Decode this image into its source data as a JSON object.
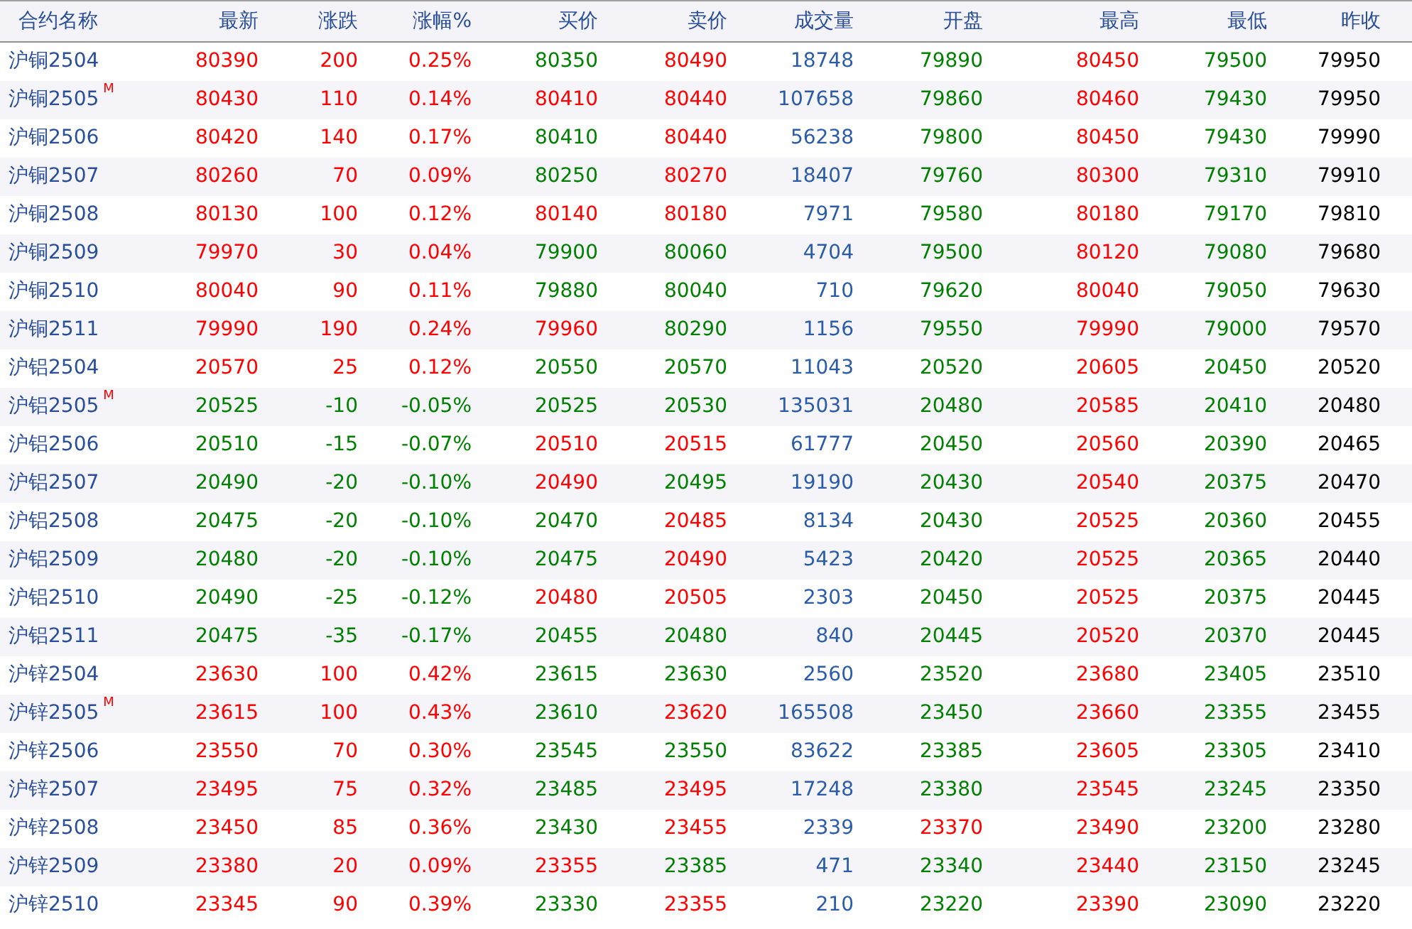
{
  "table": {
    "columns": [
      "合约名称",
      "最新",
      "涨跌",
      "涨幅%",
      "买价",
      "卖价",
      "成交量",
      "开盘",
      "最高",
      "最低",
      "昨收"
    ],
    "rows": [
      {
        "cells": [
          {
            "text": "沪铜2504",
            "color": "#2a4f9a"
          },
          {
            "text": "80390",
            "color": "#ff0000"
          },
          {
            "text": "200",
            "color": "#ff0000"
          },
          {
            "text": "0.25%",
            "color": "#ff0000"
          },
          {
            "text": "80350",
            "color": "#008000"
          },
          {
            "text": "80490",
            "color": "#ff0000"
          },
          {
            "text": "18748",
            "color": "#2a5caa"
          },
          {
            "text": "79890",
            "color": "#008000"
          },
          {
            "text": "80450",
            "color": "#ff0000"
          },
          {
            "text": "79500",
            "color": "#008000"
          },
          {
            "text": "79950",
            "color": "#000000"
          }
        ]
      },
      {
        "cells": [
          {
            "text": "沪铜2505",
            "color": "#2a4f9a",
            "badge": "M"
          },
          {
            "text": "80430",
            "color": "#ff0000"
          },
          {
            "text": "110",
            "color": "#ff0000"
          },
          {
            "text": "0.14%",
            "color": "#ff0000"
          },
          {
            "text": "80410",
            "color": "#ff0000"
          },
          {
            "text": "80440",
            "color": "#ff0000"
          },
          {
            "text": "107658",
            "color": "#2a5caa"
          },
          {
            "text": "79860",
            "color": "#008000"
          },
          {
            "text": "80460",
            "color": "#ff0000"
          },
          {
            "text": "79430",
            "color": "#008000"
          },
          {
            "text": "79950",
            "color": "#000000"
          }
        ]
      },
      {
        "cells": [
          {
            "text": "沪铜2506",
            "color": "#2a4f9a"
          },
          {
            "text": "80420",
            "color": "#ff0000"
          },
          {
            "text": "140",
            "color": "#ff0000"
          },
          {
            "text": "0.17%",
            "color": "#ff0000"
          },
          {
            "text": "80410",
            "color": "#008000"
          },
          {
            "text": "80440",
            "color": "#ff0000"
          },
          {
            "text": "56238",
            "color": "#2a5caa"
          },
          {
            "text": "79800",
            "color": "#008000"
          },
          {
            "text": "80450",
            "color": "#ff0000"
          },
          {
            "text": "79430",
            "color": "#008000"
          },
          {
            "text": "79990",
            "color": "#000000"
          }
        ]
      },
      {
        "cells": [
          {
            "text": "沪铜2507",
            "color": "#2a4f9a"
          },
          {
            "text": "80260",
            "color": "#ff0000"
          },
          {
            "text": "70",
            "color": "#ff0000"
          },
          {
            "text": "0.09%",
            "color": "#ff0000"
          },
          {
            "text": "80250",
            "color": "#008000"
          },
          {
            "text": "80270",
            "color": "#ff0000"
          },
          {
            "text": "18407",
            "color": "#2a5caa"
          },
          {
            "text": "79760",
            "color": "#008000"
          },
          {
            "text": "80300",
            "color": "#ff0000"
          },
          {
            "text": "79310",
            "color": "#008000"
          },
          {
            "text": "79910",
            "color": "#000000"
          }
        ]
      },
      {
        "cells": [
          {
            "text": "沪铜2508",
            "color": "#2a4f9a"
          },
          {
            "text": "80130",
            "color": "#ff0000"
          },
          {
            "text": "100",
            "color": "#ff0000"
          },
          {
            "text": "0.12%",
            "color": "#ff0000"
          },
          {
            "text": "80140",
            "color": "#ff0000"
          },
          {
            "text": "80180",
            "color": "#ff0000"
          },
          {
            "text": "7971",
            "color": "#2a5caa"
          },
          {
            "text": "79580",
            "color": "#008000"
          },
          {
            "text": "80180",
            "color": "#ff0000"
          },
          {
            "text": "79170",
            "color": "#008000"
          },
          {
            "text": "79810",
            "color": "#000000"
          }
        ]
      },
      {
        "cells": [
          {
            "text": "沪铜2509",
            "color": "#2a4f9a"
          },
          {
            "text": "79970",
            "color": "#ff0000"
          },
          {
            "text": "30",
            "color": "#ff0000"
          },
          {
            "text": "0.04%",
            "color": "#ff0000"
          },
          {
            "text": "79900",
            "color": "#008000"
          },
          {
            "text": "80060",
            "color": "#008000"
          },
          {
            "text": "4704",
            "color": "#2a5caa"
          },
          {
            "text": "79500",
            "color": "#008000"
          },
          {
            "text": "80120",
            "color": "#ff0000"
          },
          {
            "text": "79080",
            "color": "#008000"
          },
          {
            "text": "79680",
            "color": "#000000"
          }
        ]
      },
      {
        "cells": [
          {
            "text": "沪铜2510",
            "color": "#2a4f9a"
          },
          {
            "text": "80040",
            "color": "#ff0000"
          },
          {
            "text": "90",
            "color": "#ff0000"
          },
          {
            "text": "0.11%",
            "color": "#ff0000"
          },
          {
            "text": "79880",
            "color": "#008000"
          },
          {
            "text": "80040",
            "color": "#008000"
          },
          {
            "text": "710",
            "color": "#2a5caa"
          },
          {
            "text": "79620",
            "color": "#008000"
          },
          {
            "text": "80040",
            "color": "#ff0000"
          },
          {
            "text": "79050",
            "color": "#008000"
          },
          {
            "text": "79630",
            "color": "#000000"
          }
        ]
      },
      {
        "cells": [
          {
            "text": "沪铜2511",
            "color": "#2a4f9a"
          },
          {
            "text": "79990",
            "color": "#ff0000"
          },
          {
            "text": "190",
            "color": "#ff0000"
          },
          {
            "text": "0.24%",
            "color": "#ff0000"
          },
          {
            "text": "79960",
            "color": "#ff0000"
          },
          {
            "text": "80290",
            "color": "#008000"
          },
          {
            "text": "1156",
            "color": "#2a5caa"
          },
          {
            "text": "79550",
            "color": "#008000"
          },
          {
            "text": "79990",
            "color": "#ff0000"
          },
          {
            "text": "79000",
            "color": "#008000"
          },
          {
            "text": "79570",
            "color": "#000000"
          }
        ]
      },
      {
        "cells": [
          {
            "text": "沪铝2504",
            "color": "#2a4f9a"
          },
          {
            "text": "20570",
            "color": "#ff0000"
          },
          {
            "text": "25",
            "color": "#ff0000"
          },
          {
            "text": "0.12%",
            "color": "#ff0000"
          },
          {
            "text": "20550",
            "color": "#008000"
          },
          {
            "text": "20570",
            "color": "#008000"
          },
          {
            "text": "11043",
            "color": "#2a5caa"
          },
          {
            "text": "20520",
            "color": "#008000"
          },
          {
            "text": "20605",
            "color": "#ff0000"
          },
          {
            "text": "20450",
            "color": "#008000"
          },
          {
            "text": "20520",
            "color": "#000000"
          }
        ]
      },
      {
        "cells": [
          {
            "text": "沪铝2505",
            "color": "#2a4f9a",
            "badge": "M"
          },
          {
            "text": "20525",
            "color": "#008000"
          },
          {
            "text": "-10",
            "color": "#008000"
          },
          {
            "text": "-0.05%",
            "color": "#008000"
          },
          {
            "text": "20525",
            "color": "#008000"
          },
          {
            "text": "20530",
            "color": "#008000"
          },
          {
            "text": "135031",
            "color": "#2a5caa"
          },
          {
            "text": "20480",
            "color": "#008000"
          },
          {
            "text": "20585",
            "color": "#ff0000"
          },
          {
            "text": "20410",
            "color": "#008000"
          },
          {
            "text": "20480",
            "color": "#000000"
          }
        ]
      },
      {
        "cells": [
          {
            "text": "沪铝2506",
            "color": "#2a4f9a"
          },
          {
            "text": "20510",
            "color": "#008000"
          },
          {
            "text": "-15",
            "color": "#008000"
          },
          {
            "text": "-0.07%",
            "color": "#008000"
          },
          {
            "text": "20510",
            "color": "#ff0000"
          },
          {
            "text": "20515",
            "color": "#ff0000"
          },
          {
            "text": "61777",
            "color": "#2a5caa"
          },
          {
            "text": "20450",
            "color": "#008000"
          },
          {
            "text": "20560",
            "color": "#ff0000"
          },
          {
            "text": "20390",
            "color": "#008000"
          },
          {
            "text": "20465",
            "color": "#000000"
          }
        ]
      },
      {
        "cells": [
          {
            "text": "沪铝2507",
            "color": "#2a4f9a"
          },
          {
            "text": "20490",
            "color": "#008000"
          },
          {
            "text": "-20",
            "color": "#008000"
          },
          {
            "text": "-0.10%",
            "color": "#008000"
          },
          {
            "text": "20490",
            "color": "#ff0000"
          },
          {
            "text": "20495",
            "color": "#008000"
          },
          {
            "text": "19190",
            "color": "#2a5caa"
          },
          {
            "text": "20430",
            "color": "#008000"
          },
          {
            "text": "20540",
            "color": "#ff0000"
          },
          {
            "text": "20375",
            "color": "#008000"
          },
          {
            "text": "20470",
            "color": "#000000"
          }
        ]
      },
      {
        "cells": [
          {
            "text": "沪铝2508",
            "color": "#2a4f9a"
          },
          {
            "text": "20475",
            "color": "#008000"
          },
          {
            "text": "-20",
            "color": "#008000"
          },
          {
            "text": "-0.10%",
            "color": "#008000"
          },
          {
            "text": "20470",
            "color": "#008000"
          },
          {
            "text": "20485",
            "color": "#ff0000"
          },
          {
            "text": "8134",
            "color": "#2a5caa"
          },
          {
            "text": "20430",
            "color": "#008000"
          },
          {
            "text": "20525",
            "color": "#ff0000"
          },
          {
            "text": "20360",
            "color": "#008000"
          },
          {
            "text": "20455",
            "color": "#000000"
          }
        ]
      },
      {
        "cells": [
          {
            "text": "沪铝2509",
            "color": "#2a4f9a"
          },
          {
            "text": "20480",
            "color": "#008000"
          },
          {
            "text": "-20",
            "color": "#008000"
          },
          {
            "text": "-0.10%",
            "color": "#008000"
          },
          {
            "text": "20475",
            "color": "#008000"
          },
          {
            "text": "20490",
            "color": "#ff0000"
          },
          {
            "text": "5423",
            "color": "#2a5caa"
          },
          {
            "text": "20420",
            "color": "#008000"
          },
          {
            "text": "20525",
            "color": "#ff0000"
          },
          {
            "text": "20365",
            "color": "#008000"
          },
          {
            "text": "20440",
            "color": "#000000"
          }
        ]
      },
      {
        "cells": [
          {
            "text": "沪铝2510",
            "color": "#2a4f9a"
          },
          {
            "text": "20490",
            "color": "#008000"
          },
          {
            "text": "-25",
            "color": "#008000"
          },
          {
            "text": "-0.12%",
            "color": "#008000"
          },
          {
            "text": "20480",
            "color": "#ff0000"
          },
          {
            "text": "20505",
            "color": "#ff0000"
          },
          {
            "text": "2303",
            "color": "#2a5caa"
          },
          {
            "text": "20450",
            "color": "#008000"
          },
          {
            "text": "20525",
            "color": "#ff0000"
          },
          {
            "text": "20375",
            "color": "#008000"
          },
          {
            "text": "20445",
            "color": "#000000"
          }
        ]
      },
      {
        "cells": [
          {
            "text": "沪铝2511",
            "color": "#2a4f9a"
          },
          {
            "text": "20475",
            "color": "#008000"
          },
          {
            "text": "-35",
            "color": "#008000"
          },
          {
            "text": "-0.17%",
            "color": "#008000"
          },
          {
            "text": "20455",
            "color": "#008000"
          },
          {
            "text": "20480",
            "color": "#008000"
          },
          {
            "text": "840",
            "color": "#2a5caa"
          },
          {
            "text": "20445",
            "color": "#008000"
          },
          {
            "text": "20520",
            "color": "#ff0000"
          },
          {
            "text": "20370",
            "color": "#008000"
          },
          {
            "text": "20445",
            "color": "#000000"
          }
        ]
      },
      {
        "cells": [
          {
            "text": "沪锌2504",
            "color": "#2a4f9a"
          },
          {
            "text": "23630",
            "color": "#ff0000"
          },
          {
            "text": "100",
            "color": "#ff0000"
          },
          {
            "text": "0.42%",
            "color": "#ff0000"
          },
          {
            "text": "23615",
            "color": "#008000"
          },
          {
            "text": "23630",
            "color": "#008000"
          },
          {
            "text": "2560",
            "color": "#2a5caa"
          },
          {
            "text": "23520",
            "color": "#008000"
          },
          {
            "text": "23680",
            "color": "#ff0000"
          },
          {
            "text": "23405",
            "color": "#008000"
          },
          {
            "text": "23510",
            "color": "#000000"
          }
        ]
      },
      {
        "cells": [
          {
            "text": "沪锌2505",
            "color": "#2a4f9a",
            "badge": "M"
          },
          {
            "text": "23615",
            "color": "#ff0000"
          },
          {
            "text": "100",
            "color": "#ff0000"
          },
          {
            "text": "0.43%",
            "color": "#ff0000"
          },
          {
            "text": "23610",
            "color": "#008000"
          },
          {
            "text": "23620",
            "color": "#ff0000"
          },
          {
            "text": "165508",
            "color": "#2a5caa"
          },
          {
            "text": "23450",
            "color": "#008000"
          },
          {
            "text": "23660",
            "color": "#ff0000"
          },
          {
            "text": "23355",
            "color": "#008000"
          },
          {
            "text": "23455",
            "color": "#000000"
          }
        ]
      },
      {
        "cells": [
          {
            "text": "沪锌2506",
            "color": "#2a4f9a"
          },
          {
            "text": "23550",
            "color": "#ff0000"
          },
          {
            "text": "70",
            "color": "#ff0000"
          },
          {
            "text": "0.30%",
            "color": "#ff0000"
          },
          {
            "text": "23545",
            "color": "#008000"
          },
          {
            "text": "23550",
            "color": "#008000"
          },
          {
            "text": "83622",
            "color": "#2a5caa"
          },
          {
            "text": "23385",
            "color": "#008000"
          },
          {
            "text": "23605",
            "color": "#ff0000"
          },
          {
            "text": "23305",
            "color": "#008000"
          },
          {
            "text": "23410",
            "color": "#000000"
          }
        ]
      },
      {
        "cells": [
          {
            "text": "沪锌2507",
            "color": "#2a4f9a"
          },
          {
            "text": "23495",
            "color": "#ff0000"
          },
          {
            "text": "75",
            "color": "#ff0000"
          },
          {
            "text": "0.32%",
            "color": "#ff0000"
          },
          {
            "text": "23485",
            "color": "#008000"
          },
          {
            "text": "23495",
            "color": "#ff0000"
          },
          {
            "text": "17248",
            "color": "#2a5caa"
          },
          {
            "text": "23380",
            "color": "#008000"
          },
          {
            "text": "23545",
            "color": "#ff0000"
          },
          {
            "text": "23245",
            "color": "#008000"
          },
          {
            "text": "23350",
            "color": "#000000"
          }
        ]
      },
      {
        "cells": [
          {
            "text": "沪锌2508",
            "color": "#2a4f9a"
          },
          {
            "text": "23450",
            "color": "#ff0000"
          },
          {
            "text": "85",
            "color": "#ff0000"
          },
          {
            "text": "0.36%",
            "color": "#ff0000"
          },
          {
            "text": "23430",
            "color": "#008000"
          },
          {
            "text": "23455",
            "color": "#ff0000"
          },
          {
            "text": "2339",
            "color": "#2a5caa"
          },
          {
            "text": "23370",
            "color": "#ff0000"
          },
          {
            "text": "23490",
            "color": "#ff0000"
          },
          {
            "text": "23200",
            "color": "#008000"
          },
          {
            "text": "23280",
            "color": "#000000"
          }
        ]
      },
      {
        "cells": [
          {
            "text": "沪锌2509",
            "color": "#2a4f9a"
          },
          {
            "text": "23380",
            "color": "#ff0000"
          },
          {
            "text": "20",
            "color": "#ff0000"
          },
          {
            "text": "0.09%",
            "color": "#ff0000"
          },
          {
            "text": "23355",
            "color": "#ff0000"
          },
          {
            "text": "23385",
            "color": "#008000"
          },
          {
            "text": "471",
            "color": "#2a5caa"
          },
          {
            "text": "23340",
            "color": "#008000"
          },
          {
            "text": "23440",
            "color": "#ff0000"
          },
          {
            "text": "23150",
            "color": "#008000"
          },
          {
            "text": "23245",
            "color": "#000000"
          }
        ]
      },
      {
        "cells": [
          {
            "text": "沪锌2510",
            "color": "#2a4f9a"
          },
          {
            "text": "23345",
            "color": "#ff0000"
          },
          {
            "text": "90",
            "color": "#ff0000"
          },
          {
            "text": "0.39%",
            "color": "#ff0000"
          },
          {
            "text": "23330",
            "color": "#008000"
          },
          {
            "text": "23355",
            "color": "#ff0000"
          },
          {
            "text": "210",
            "color": "#2a5caa"
          },
          {
            "text": "23220",
            "color": "#008000"
          },
          {
            "text": "23390",
            "color": "#ff0000"
          },
          {
            "text": "23090",
            "color": "#008000"
          },
          {
            "text": "23220",
            "color": "#000000"
          }
        ]
      }
    ]
  }
}
